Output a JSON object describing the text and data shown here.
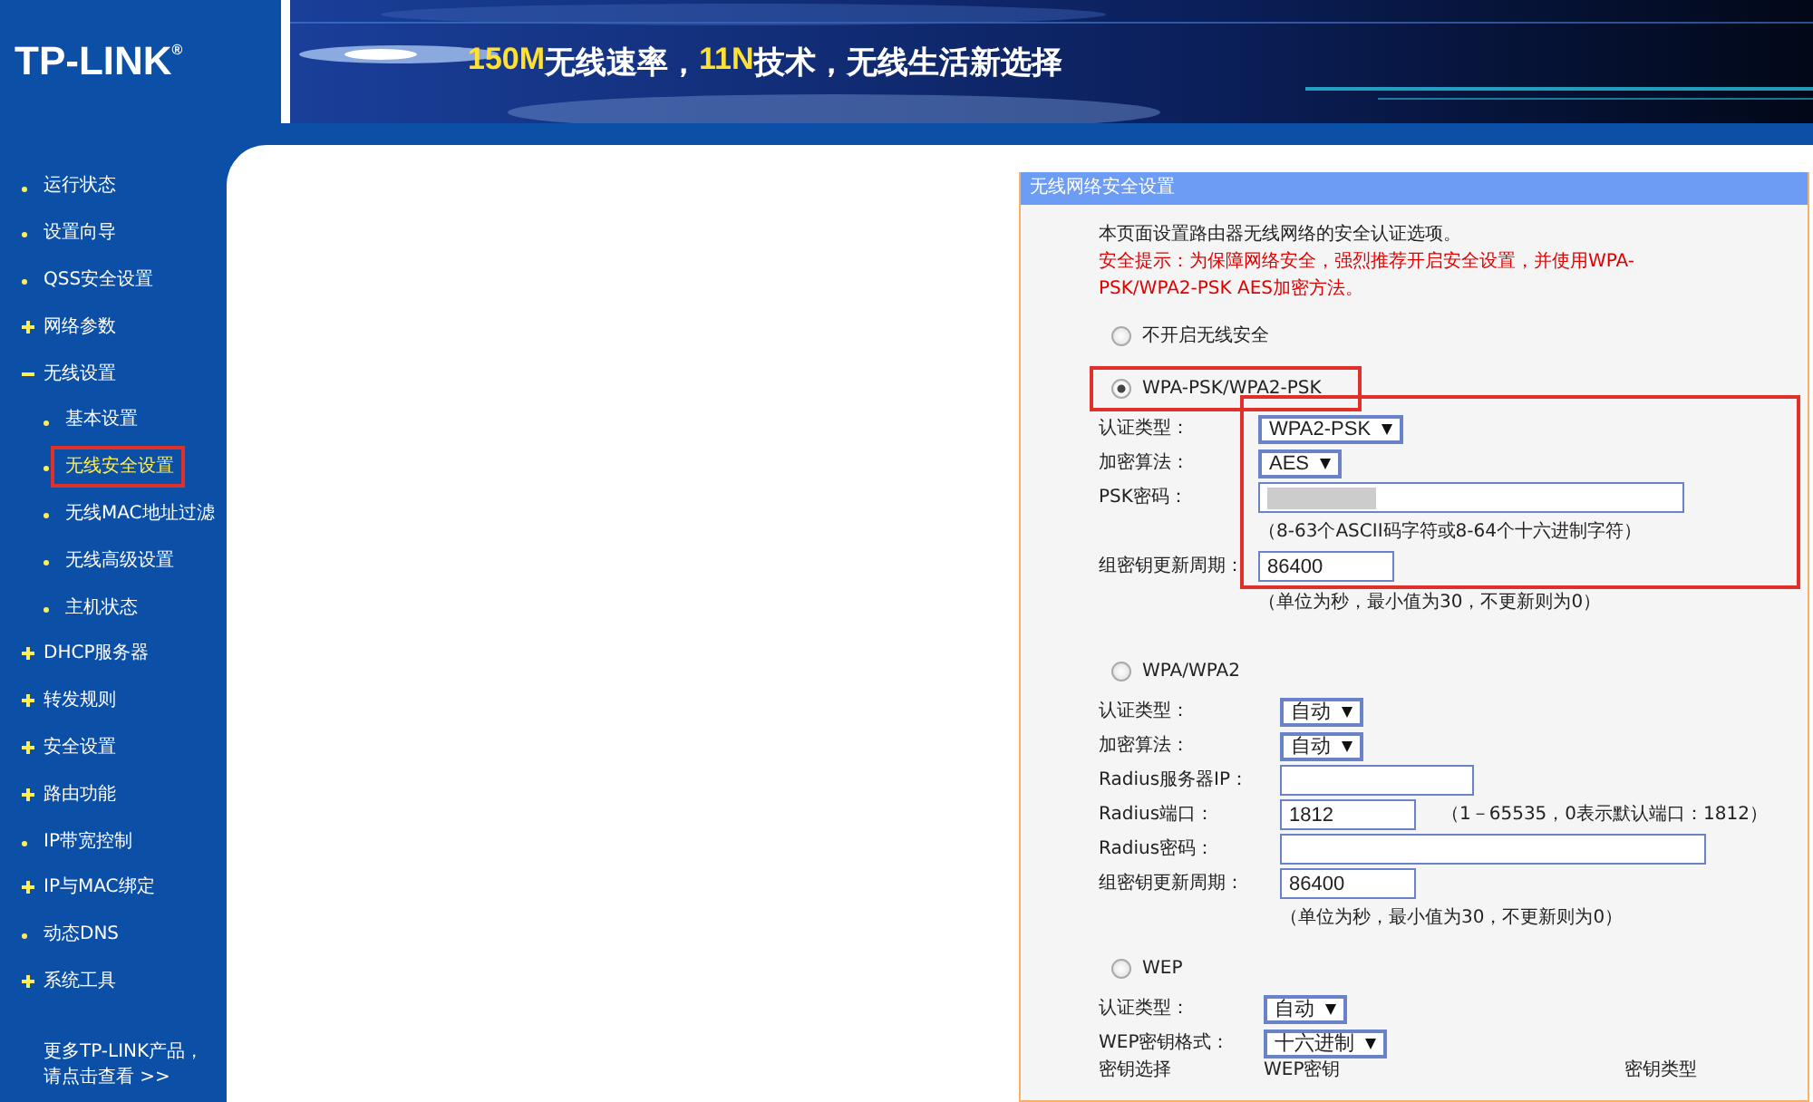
{
  "header": {
    "logo": "TP-LINK",
    "logo_mark": "®",
    "slogan": [
      {
        "text": "150M",
        "highlight": true
      },
      {
        "text": "无线速率，",
        "highlight": false
      },
      {
        "text": "11N",
        "highlight": true
      },
      {
        "text": "技术，无线生活新选择",
        "highlight": false
      }
    ]
  },
  "sidebar": {
    "items": [
      {
        "label": "运行状态",
        "kind": "leaf",
        "selected": false,
        "annotated": false
      },
      {
        "label": "设置向导",
        "kind": "leaf",
        "selected": false,
        "annotated": false
      },
      {
        "label": "QSS安全设置",
        "kind": "leaf",
        "selected": false,
        "annotated": false
      },
      {
        "label": "网络参数",
        "kind": "collapsed",
        "selected": false,
        "annotated": false
      },
      {
        "label": "无线设置",
        "kind": "expanded",
        "selected": false,
        "annotated": false,
        "children": [
          {
            "label": "基本设置",
            "kind": "leaf",
            "selected": false,
            "annotated": false
          },
          {
            "label": "无线安全设置",
            "kind": "leaf",
            "selected": true,
            "annotated": true
          },
          {
            "label": "无线MAC地址过滤",
            "kind": "leaf",
            "selected": false,
            "annotated": false
          },
          {
            "label": "无线高级设置",
            "kind": "leaf",
            "selected": false,
            "annotated": false
          },
          {
            "label": "主机状态",
            "kind": "leaf",
            "selected": false,
            "annotated": false
          }
        ]
      },
      {
        "label": "DHCP服务器",
        "kind": "collapsed",
        "selected": false,
        "annotated": false
      },
      {
        "label": "转发规则",
        "kind": "collapsed",
        "selected": false,
        "annotated": false
      },
      {
        "label": "安全设置",
        "kind": "collapsed",
        "selected": false,
        "annotated": false
      },
      {
        "label": "路由功能",
        "kind": "collapsed",
        "selected": false,
        "annotated": false
      },
      {
        "label": "IP带宽控制",
        "kind": "leaf",
        "selected": false,
        "annotated": false
      },
      {
        "label": "IP与MAC绑定",
        "kind": "collapsed",
        "selected": false,
        "annotated": false
      },
      {
        "label": "动态DNS",
        "kind": "leaf",
        "selected": false,
        "annotated": false
      },
      {
        "label": "系统工具",
        "kind": "collapsed",
        "selected": false,
        "annotated": false
      }
    ],
    "footer": [
      "更多TP-LINK产品，",
      "请点击查看 >>"
    ]
  },
  "panel": {
    "title": "无线网络安全设置",
    "intro": "本页面设置路由器无线网络的安全认证选项。",
    "warning": "安全提示：为保障网络安全，强烈推荐开启安全设置，并使用WPA-PSK/WPA2-PSK AES加密方法。",
    "options": [
      {
        "kind": "plain",
        "label": "不开启无线安全",
        "selected": false,
        "annotated": false
      },
      {
        "kind": "wpa-psk",
        "label": "WPA-PSK/WPA2-PSK",
        "selected": true,
        "annotated": true,
        "fields": [
          {
            "kind": "select",
            "label": "认证类型：",
            "value": "WPA2-PSK",
            "framed": true
          },
          {
            "kind": "select",
            "label": "加密算法：",
            "value": "AES",
            "framed": true
          },
          {
            "kind": "wide-input",
            "label": "PSK密码：",
            "blurred": true,
            "framed": true
          },
          {
            "kind": "hint",
            "text": "（8-63个ASCII码字符或8-64个十六进制字符）",
            "framed": true
          },
          {
            "kind": "input",
            "label": "组密钥更新周期：",
            "value": "86400",
            "framed": true
          },
          {
            "kind": "hint",
            "text": "（单位为秒，最小值为30，不更新则为0）",
            "framed": false
          }
        ]
      },
      {
        "kind": "wpa",
        "label": "WPA/WPA2",
        "selected": false,
        "annotated": false,
        "fields": [
          {
            "kind": "select",
            "label": "认证类型：",
            "value": "自动",
            "framed": false
          },
          {
            "kind": "select",
            "label": "加密算法：",
            "value": "自动",
            "framed": false
          },
          {
            "kind": "mid-input",
            "label": "Radius服务器IP：",
            "framed": false
          },
          {
            "kind": "input",
            "label": "Radius端口：",
            "value": "1812",
            "note": "（1－65535，0表示默认端口：1812）",
            "framed": false
          },
          {
            "kind": "wide-input",
            "label": "Radius密码：",
            "framed": false
          },
          {
            "kind": "input",
            "label": "组密钥更新周期：",
            "value": "86400",
            "framed": false
          },
          {
            "kind": "hint",
            "text": "（单位为秒，最小值为30，不更新则为0）",
            "framed": false
          }
        ]
      },
      {
        "kind": "wep",
        "label": "WEP",
        "selected": false,
        "annotated": false,
        "fields": [
          {
            "kind": "select",
            "label": "认证类型：",
            "value": "自动",
            "framed": false
          },
          {
            "kind": "select",
            "label": "WEP密钥格式：",
            "value": "十六进制",
            "framed": false
          },
          {
            "kind": "headers",
            "labels": [
              "密钥选择",
              "WEP密钥",
              "密钥类型"
            ],
            "framed": false
          }
        ]
      }
    ]
  }
}
